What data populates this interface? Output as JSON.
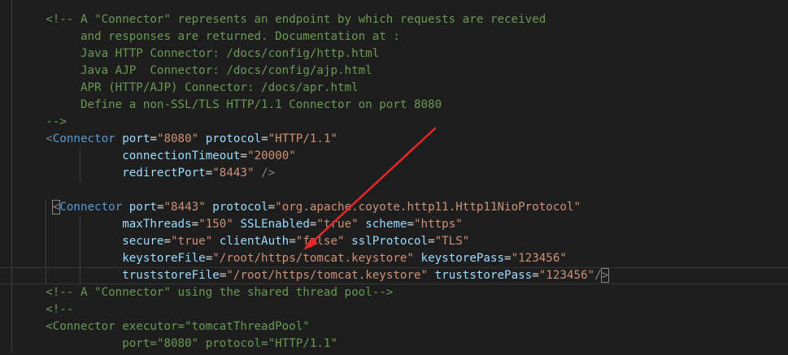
{
  "editor": {
    "lines": [
      {
        "indent": "",
        "tokens": []
      },
      {
        "indent": "      ",
        "tokens": [
          {
            "t": "comment",
            "v": "<!-- A \"Connector\" represents an endpoint by which requests are received"
          }
        ]
      },
      {
        "indent": "      ",
        "tokens": [
          {
            "t": "comment",
            "v": "     and responses are returned. Documentation at :"
          }
        ]
      },
      {
        "indent": "      ",
        "tokens": [
          {
            "t": "comment",
            "v": "     Java HTTP Connector: /docs/config/http.html"
          }
        ]
      },
      {
        "indent": "      ",
        "tokens": [
          {
            "t": "comment",
            "v": "     Java AJP  Connector: /docs/config/ajp.html"
          }
        ]
      },
      {
        "indent": "      ",
        "tokens": [
          {
            "t": "comment",
            "v": "     APR (HTTP/AJP) Connector: /docs/apr.html"
          }
        ]
      },
      {
        "indent": "      ",
        "tokens": [
          {
            "t": "comment",
            "v": "     Define a non-SSL/TLS HTTP/1.1 Connector on port 8080"
          }
        ]
      },
      {
        "indent": "      ",
        "tokens": [
          {
            "t": "comment",
            "v": "-->"
          }
        ]
      },
      {
        "indent": "      ",
        "tokens": [
          {
            "t": "punct",
            "v": "<"
          },
          {
            "t": "tag",
            "v": "Connector"
          },
          {
            "t": "plain",
            "v": " "
          },
          {
            "t": "attr",
            "v": "port"
          },
          {
            "t": "eq",
            "v": "="
          },
          {
            "t": "str",
            "v": "\"8080\""
          },
          {
            "t": "plain",
            "v": " "
          },
          {
            "t": "attr",
            "v": "protocol"
          },
          {
            "t": "eq",
            "v": "="
          },
          {
            "t": "str",
            "v": "\"HTTP/1.1\""
          }
        ]
      },
      {
        "indent": "                 ",
        "tokens": [
          {
            "t": "attr",
            "v": "connectionTimeout"
          },
          {
            "t": "eq",
            "v": "="
          },
          {
            "t": "str",
            "v": "\"20000\""
          }
        ]
      },
      {
        "indent": "                 ",
        "tokens": [
          {
            "t": "attr",
            "v": "redirectPort"
          },
          {
            "t": "eq",
            "v": "="
          },
          {
            "t": "str",
            "v": "\"8443\""
          },
          {
            "t": "plain",
            "v": " "
          },
          {
            "t": "punct",
            "v": "/>"
          }
        ]
      },
      {
        "indent": "",
        "tokens": []
      },
      {
        "indent": "       ",
        "tokens": [
          {
            "t": "punct",
            "v": "<"
          },
          {
            "t": "tag",
            "v": "Connector"
          },
          {
            "t": "plain",
            "v": " "
          },
          {
            "t": "attr",
            "v": "port"
          },
          {
            "t": "eq",
            "v": "="
          },
          {
            "t": "str",
            "v": "\"8443\""
          },
          {
            "t": "plain",
            "v": " "
          },
          {
            "t": "attr",
            "v": "protocol"
          },
          {
            "t": "eq",
            "v": "="
          },
          {
            "t": "str",
            "v": "\"org.apache.coyote.http11.Http11NioProtocol\""
          }
        ]
      },
      {
        "indent": "                 ",
        "tokens": [
          {
            "t": "attr",
            "v": "maxThreads"
          },
          {
            "t": "eq",
            "v": "="
          },
          {
            "t": "str",
            "v": "\"150\""
          },
          {
            "t": "plain",
            "v": " "
          },
          {
            "t": "attr",
            "v": "SSLEnabled"
          },
          {
            "t": "eq",
            "v": "="
          },
          {
            "t": "str",
            "v": "\"true\""
          },
          {
            "t": "plain",
            "v": " "
          },
          {
            "t": "attr",
            "v": "scheme"
          },
          {
            "t": "eq",
            "v": "="
          },
          {
            "t": "str",
            "v": "\"https\""
          }
        ]
      },
      {
        "indent": "                 ",
        "tokens": [
          {
            "t": "attr",
            "v": "secure"
          },
          {
            "t": "eq",
            "v": "="
          },
          {
            "t": "str",
            "v": "\"true\""
          },
          {
            "t": "plain",
            "v": " "
          },
          {
            "t": "attr",
            "v": "clientAuth"
          },
          {
            "t": "eq",
            "v": "="
          },
          {
            "t": "str",
            "v": "\"false\""
          },
          {
            "t": "plain",
            "v": " "
          },
          {
            "t": "attr",
            "v": "sslProtocol"
          },
          {
            "t": "eq",
            "v": "="
          },
          {
            "t": "str",
            "v": "\"TLS\""
          }
        ]
      },
      {
        "indent": "                 ",
        "tokens": [
          {
            "t": "attr",
            "v": "keystoreFile"
          },
          {
            "t": "eq",
            "v": "="
          },
          {
            "t": "str",
            "v": "\"/root/https/tomcat.keystore\""
          },
          {
            "t": "plain",
            "v": " "
          },
          {
            "t": "attr",
            "v": "keystorePass"
          },
          {
            "t": "eq",
            "v": "="
          },
          {
            "t": "str",
            "v": "\"123456\""
          }
        ]
      },
      {
        "indent": "                 ",
        "tokens": [
          {
            "t": "attr",
            "v": "truststoreFile"
          },
          {
            "t": "eq",
            "v": "="
          },
          {
            "t": "str",
            "v": "\"/root/https/tomcat.keystore\""
          },
          {
            "t": "plain",
            "v": " "
          },
          {
            "t": "attr",
            "v": "truststorePass"
          },
          {
            "t": "eq",
            "v": "="
          },
          {
            "t": "str",
            "v": "\"123456\""
          },
          {
            "t": "punct",
            "v": "/"
          },
          {
            "t": "punct",
            "v": ">"
          }
        ]
      },
      {
        "indent": "      ",
        "tokens": [
          {
            "t": "comment",
            "v": "<!-- A \"Connector\" using the shared thread pool-->"
          }
        ]
      },
      {
        "indent": "      ",
        "tokens": [
          {
            "t": "comment",
            "v": "<!--"
          }
        ]
      },
      {
        "indent": "      ",
        "tokens": [
          {
            "t": "comment",
            "v": "<Connector executor=\"tomcatThreadPool\""
          }
        ]
      },
      {
        "indent": "                 ",
        "tokens": [
          {
            "t": "comment",
            "v": "port=\"8080\" protocol=\"HTTP/1.1\""
          }
        ]
      }
    ]
  },
  "annotation": {
    "arrow_color": "#e8262b"
  }
}
